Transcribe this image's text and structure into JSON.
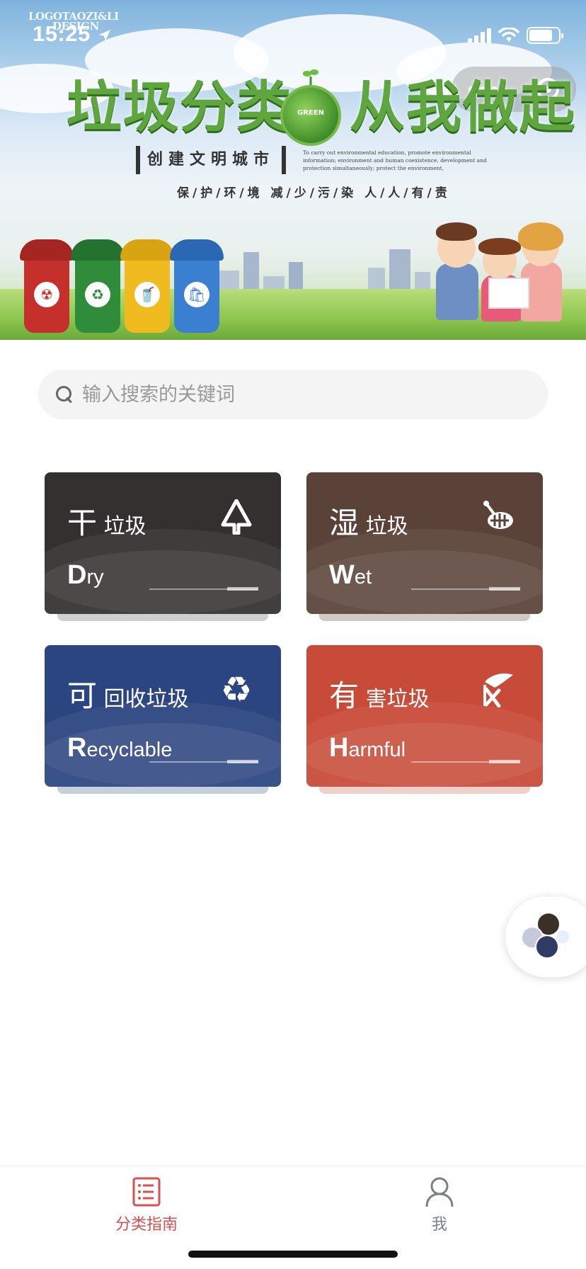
{
  "status_bar": {
    "time": "15:25"
  },
  "banner": {
    "watermark_line1": "LOGOTAOZI&LI",
    "watermark_line2": "DESIGN",
    "slogan_left": "垃圾分类",
    "slogan_right": "从我做起",
    "globe_label": "GREEN",
    "sub_slogan": "创建文明城市",
    "english_note": "To carry out environmental education, promote environmental information; environment and human coexistence, development and protection simultaneously; protect the environment,",
    "motto": "保/护/环/境  减/少/污/染  人/人/有/责"
  },
  "search": {
    "placeholder": "输入搜索的关键词",
    "value": ""
  },
  "categories": [
    {
      "title_first": "干",
      "title_rest": "垃圾",
      "en_first": "D",
      "en_rest": "ry",
      "color": "#333130",
      "icon": "tree-icon"
    },
    {
      "title_first": "湿",
      "title_rest": "垃圾",
      "en_first": "W",
      "en_rest": "et",
      "color": "#5b4238",
      "icon": "fish-bone-icon"
    },
    {
      "title_first": "可",
      "title_rest": "回收垃圾",
      "en_first": "R",
      "en_rest": "ecyclable",
      "color": "#2b4580",
      "icon": "recycle-icon"
    },
    {
      "title_first": "有",
      "title_rest": "害垃圾",
      "en_first": "H",
      "en_rest": "armful",
      "color": "#c84a38",
      "icon": "battery-hazard-icon"
    }
  ],
  "tabbar": {
    "tabs": [
      {
        "label": "分类指南",
        "icon": "list-icon",
        "active": true,
        "color": "#d95050"
      },
      {
        "label": "我",
        "icon": "user-icon",
        "active": false,
        "color": "#7a7f88"
      }
    ]
  }
}
